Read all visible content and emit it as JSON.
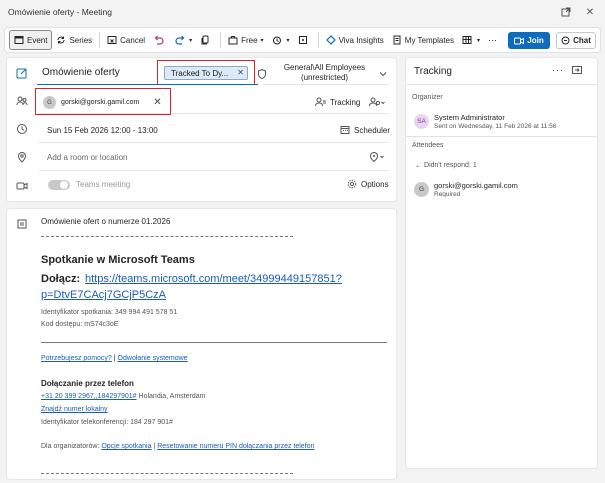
{
  "window": {
    "title": "Omówienie oferty - Meeting"
  },
  "toolbar": {
    "event": "Event",
    "series": "Series",
    "cancel": "Cancel",
    "free": "Free",
    "viva": "Viva Insights",
    "templates": "My Templates",
    "join": "Join",
    "chat": "Chat"
  },
  "form": {
    "subject": "Omówienie oferty",
    "tracked_chip": "Tracked To Dy...",
    "sensitivity_line1": "General\\All Employees",
    "sensitivity_line2": "(unrestricted)",
    "attendee_initial": "G",
    "attendee_email": "gorski@gorski.gamil.com",
    "tracking_label": "Tracking",
    "datetime": "Sun 15 Feb 2026 12:00 - 13:00",
    "scheduler_label": "Scheduler",
    "location_placeholder": "Add a room or location",
    "teams_meeting_label": "Teams meeting",
    "options_label": "Options"
  },
  "body": {
    "intro": "Omówienie ofert o numerze 01.2026",
    "separator": "________________________________________________________________________________",
    "heading": "Spotkanie w Microsoft Teams",
    "join_label": "Dołącz: ",
    "join_link_line1": "https://teams.microsoft.com/meet/34999449157851?",
    "join_link_line2": "p=DtvE7CAcj7GCjP5CzA",
    "meeting_id": "Identyfikator spotkania: 349 994 491 578 51",
    "passcode": "Kod dostępu: mS74c3oE",
    "help_link": "Potrzebujesz pomocy?",
    "pipe": " | ",
    "system_reference": "Odwołanie systemowe",
    "phone_heading": "Dołączanie przez telefon",
    "phone_number": "+31 20 399 2967,,184297901#",
    "phone_location": "  Holandia, Amsterdam",
    "find_local": "Znajdź numer lokalny",
    "conference_id": "Identyfikator telekonferencji: 184 297 901#",
    "organizers_prefix": "Dla organizatorów: ",
    "meeting_options": "Opcje spotkania",
    "reset_pin": "Resetowanie numeru PIN dołączania przez telefon"
  },
  "tracking": {
    "title": "Tracking",
    "organizer_label": "Organizer",
    "organizer_initials": "SA",
    "organizer_name": "System Administrator",
    "organizer_sent": "Sent on Wednesday, 11 Feb 2026 at 11:56",
    "attendees_label": "Attendees",
    "didnt_respond": "Didn't respond: 1",
    "attendee_initial": "G",
    "attendee_email": "gorski@gorski.gamil.com",
    "attendee_role": "Required"
  },
  "colors": {
    "accent": "#0f6cbd",
    "highlight_box": "#d9232d",
    "chip_bg": "#dce9f7",
    "link": "#1a5bbd"
  }
}
